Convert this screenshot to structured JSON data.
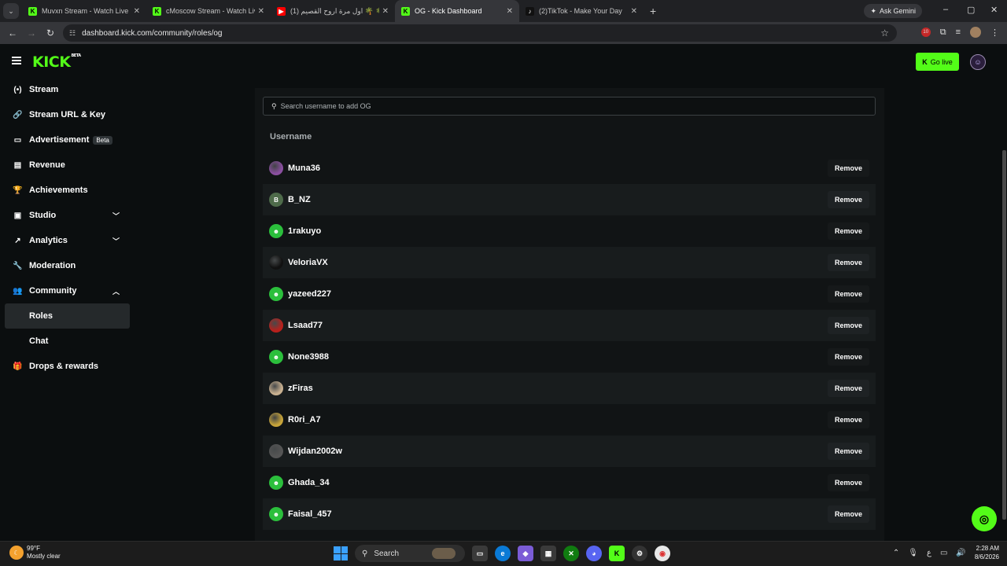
{
  "browser": {
    "tabs": [
      {
        "title": "Muvxn Stream - Watch Live on",
        "favicon": "kick",
        "active": false
      },
      {
        "title": "cMoscow Stream - Watch Live o",
        "favicon": "kick",
        "active": false
      },
      {
        "title": "اول مرة اروح القصيم (1) 🌴 🌴 -",
        "favicon": "youtube",
        "active": false
      },
      {
        "title": "OG - Kick Dashboard",
        "favicon": "kick",
        "active": true
      },
      {
        "title": "(2)TikTok - Make Your Day",
        "favicon": "tiktok",
        "active": false
      }
    ],
    "ask_gemini": "Ask Gemini",
    "url": "dashboard.kick.com/community/roles/og",
    "extension_badge": "10"
  },
  "header": {
    "logo": "KICK",
    "logo_badge": "BETA",
    "go_live": "Go live"
  },
  "sidebar": {
    "items": [
      {
        "label": "Stream",
        "icon": "broadcast-icon"
      },
      {
        "label": "Stream URL & Key",
        "icon": "link-icon"
      },
      {
        "label": "Advertisement",
        "icon": "ad-icon",
        "badge": "Beta"
      },
      {
        "label": "Revenue",
        "icon": "revenue-icon"
      },
      {
        "label": "Achievements",
        "icon": "trophy-icon"
      },
      {
        "label": "Studio",
        "icon": "studio-icon",
        "expandable": "collapsed"
      },
      {
        "label": "Analytics",
        "icon": "analytics-icon",
        "expandable": "collapsed"
      },
      {
        "label": "Moderation",
        "icon": "wrench-icon"
      },
      {
        "label": "Community",
        "icon": "community-icon",
        "expandable": "expanded"
      }
    ],
    "sub_items": [
      {
        "label": "Roles",
        "active": true
      },
      {
        "label": "Chat",
        "active": false
      }
    ],
    "drops": {
      "label": "Drops & rewards",
      "icon": "gift-icon"
    }
  },
  "main": {
    "search_placeholder": "Search username to add OG",
    "column_header": "Username",
    "remove_label": "Remove",
    "users": [
      {
        "name": "Muna36",
        "avatar": "photo",
        "color": "#8a4fa0"
      },
      {
        "name": "B_NZ",
        "avatar": "initial",
        "initial": "B",
        "color": "#4e6b4a"
      },
      {
        "name": "1rakuyo",
        "avatar": "default",
        "color": "#2bbf3c"
      },
      {
        "name": "VeloriaVX",
        "avatar": "photo",
        "color": "#111111"
      },
      {
        "name": "yazeed227",
        "avatar": "default",
        "color": "#2bbf3c"
      },
      {
        "name": "Lsaad77",
        "avatar": "photo",
        "color": "#b8201c"
      },
      {
        "name": "None3988",
        "avatar": "default",
        "color": "#2bbf3c"
      },
      {
        "name": "zFiras",
        "avatar": "photo",
        "color": "#c8b090"
      },
      {
        "name": "R0ri_A7",
        "avatar": "photo",
        "color": "#c7a43a"
      },
      {
        "name": "Wijdan2002w",
        "avatar": "photo",
        "color": "#555555"
      },
      {
        "name": "Ghada_34",
        "avatar": "default",
        "color": "#2bbf3c"
      },
      {
        "name": "Faisal_457",
        "avatar": "default",
        "color": "#2bbf3c"
      }
    ]
  },
  "taskbar": {
    "temperature": "99°F",
    "condition": "Mostly clear",
    "search": "Search",
    "time": "2:28 AM",
    "date": "8/6/2026"
  },
  "colors": {
    "brand": "#53fc18",
    "background": "#0b0e0f",
    "panel": "#111415"
  }
}
